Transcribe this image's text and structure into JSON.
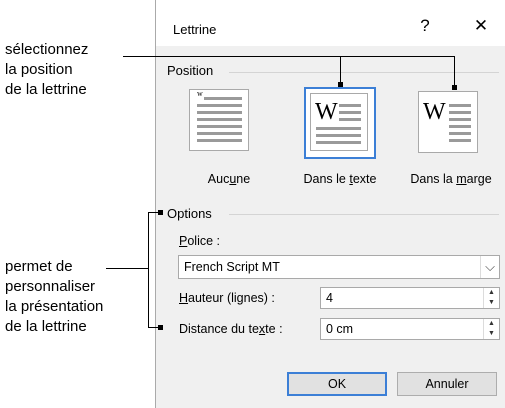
{
  "annotations": {
    "top": [
      "sélectionnez",
      "la position",
      "de la lettrine"
    ],
    "bottom": [
      "permet de",
      "personnaliser",
      "la présentation",
      "de la lettrine"
    ]
  },
  "dialog": {
    "title": "Lettrine",
    "help_label": "?",
    "close_label": "✕",
    "position_section": "Position",
    "options": [
      {
        "pre": "Auc",
        "u": "u",
        "post": "ne"
      },
      {
        "pre": "Dans le ",
        "u": "t",
        "post": "exte"
      },
      {
        "pre": "Dans la ",
        "u": "m",
        "post": "arge"
      }
    ],
    "options_section": "Options",
    "font_label": {
      "pre": "",
      "u": "P",
      "post": "olice :"
    },
    "font_value": "French Script MT",
    "height_label": {
      "pre": "",
      "u": "H",
      "post": "auteur (lignes) :"
    },
    "height_value": "4",
    "distance_label": {
      "pre": "Distance du te",
      "u": "x",
      "post": "te :"
    },
    "distance_value": "0 cm",
    "ok_label": "OK",
    "cancel_label": "Annuler"
  },
  "icons": {
    "chevron": "⌵",
    "up": "▲",
    "down": "▼",
    "dropcap_glyph": "W",
    "small_glyph": "w"
  }
}
